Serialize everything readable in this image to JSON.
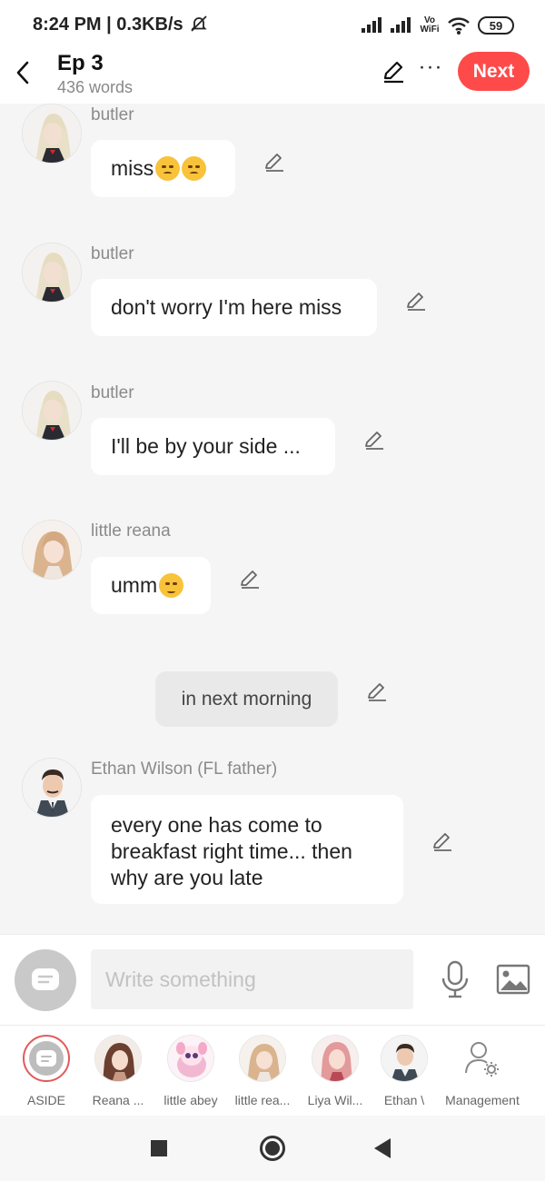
{
  "status_bar": {
    "time": "8:24 PM | 0.3KB/s",
    "network": "Vo WiFi",
    "battery": "59"
  },
  "header": {
    "title": "Ep 3",
    "word_count": "436 words",
    "next_label": "Next"
  },
  "messages": [
    {
      "type": "character",
      "name": "butler",
      "text": "miss",
      "emoji": [
        "pensive-face",
        "worried-face"
      ]
    },
    {
      "type": "character",
      "name": "butler",
      "text": "don't worry I'm here miss"
    },
    {
      "type": "character",
      "name": "butler",
      "text": "I'll be by your side ..."
    },
    {
      "type": "character",
      "name": "little reana",
      "text": "umm",
      "emoji": [
        "smiling-face"
      ]
    },
    {
      "type": "aside",
      "text": "in next morning"
    },
    {
      "type": "character",
      "name": "Ethan Wilson (FL father)",
      "text": "every one has come to breakfast right time... then why are you late"
    }
  ],
  "composer": {
    "placeholder": "Write something"
  },
  "characters": [
    {
      "label": "ASIDE",
      "icon": "aside-icon",
      "active": true
    },
    {
      "label": "Reana ...",
      "icon": "avatar-reana"
    },
    {
      "label": "little abey",
      "icon": "avatar-little-abey"
    },
    {
      "label": "little rea...",
      "icon": "avatar-little-reana"
    },
    {
      "label": "Liya Wil...",
      "icon": "avatar-liya"
    },
    {
      "label": "Ethan \\",
      "icon": "avatar-ethan"
    },
    {
      "label": "Management",
      "icon": "user-gear-icon"
    }
  ],
  "colors": {
    "accent": "#ff4a4a",
    "chat_background": "#f5f5f5",
    "bubble": "#ffffff",
    "aside_bubble": "#e9e9e9"
  }
}
